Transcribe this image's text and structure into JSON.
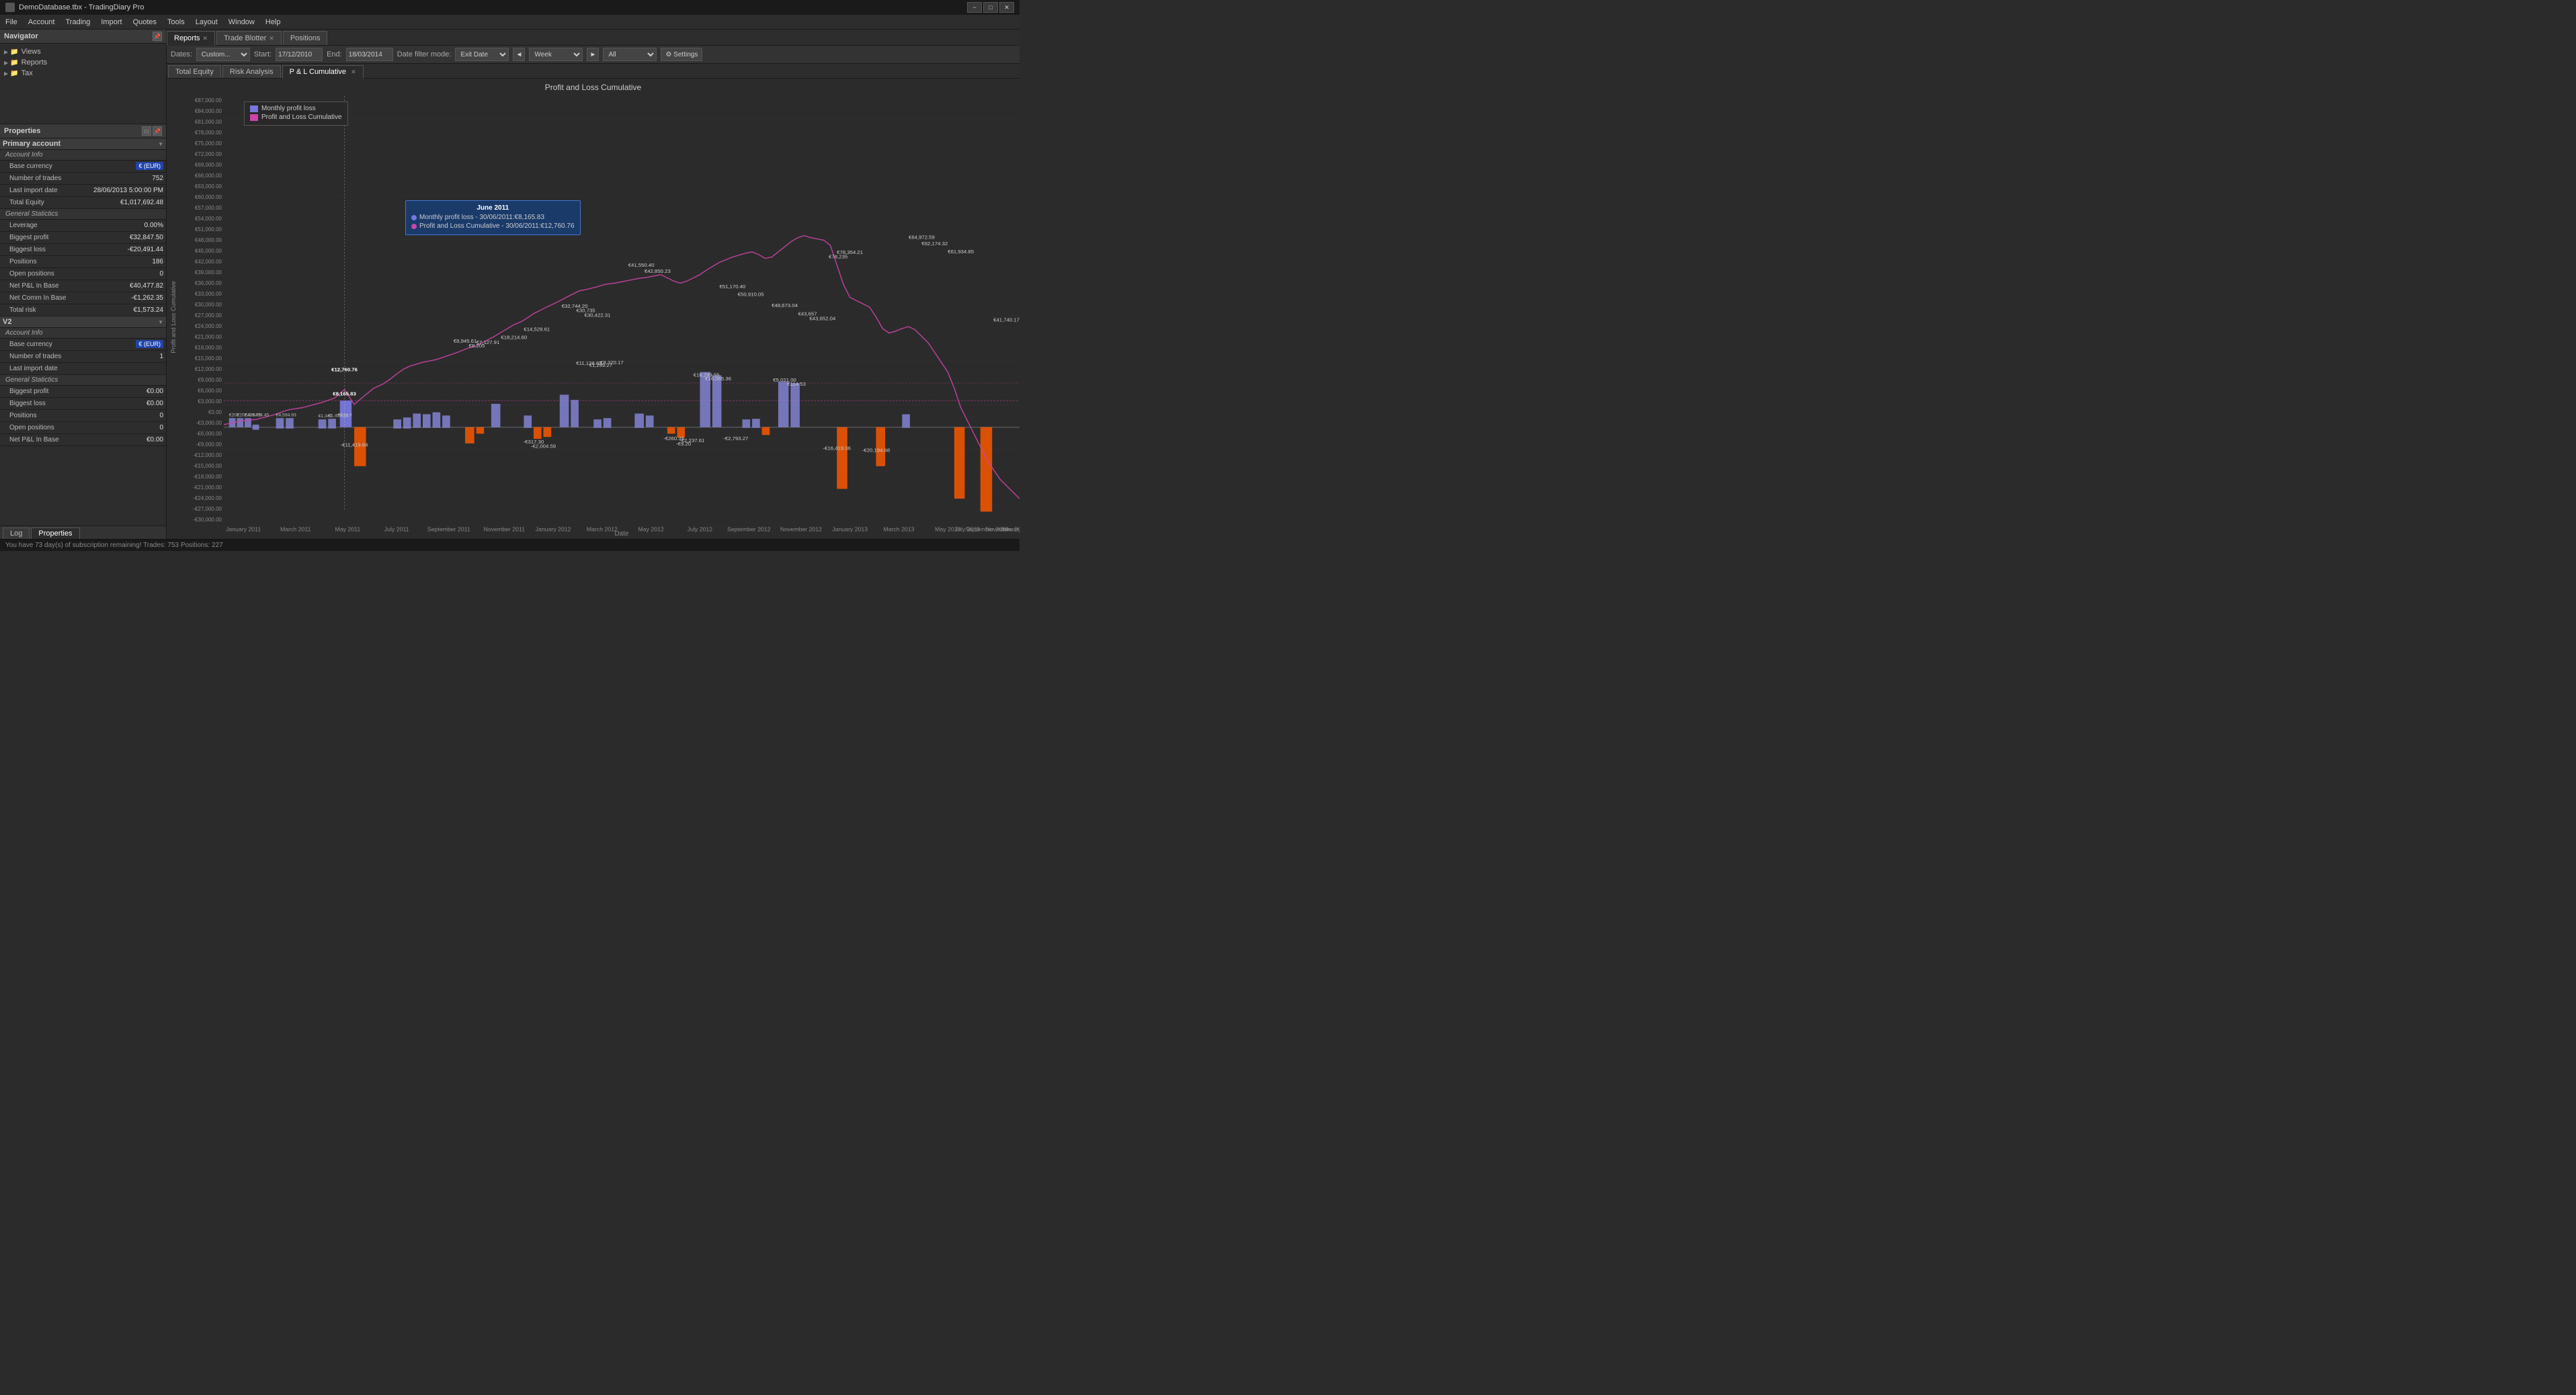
{
  "titlebar": {
    "title": "DemoDatabase.tbx - TradingDiary Pro",
    "icon": "app-icon",
    "min_btn": "−",
    "max_btn": "□",
    "close_btn": "✕"
  },
  "menubar": {
    "items": [
      "File",
      "Account",
      "Trading",
      "Import",
      "Quotes",
      "Tools",
      "Layout",
      "Window",
      "Help"
    ]
  },
  "tabs": [
    {
      "label": "Reports",
      "closeable": true,
      "active": true
    },
    {
      "label": "Trade Blotter",
      "closeable": true,
      "active": false
    },
    {
      "label": "Positions",
      "closeable": false,
      "active": false
    }
  ],
  "toolbar": {
    "dates_label": "Dates:",
    "dates_value": "Custom...",
    "start_label": "Start:",
    "start_value": "17/12/2010",
    "end_label": "End:",
    "end_value": "18/03/2014",
    "filter_label": "Date filter mode:",
    "filter_value": "Exit Date",
    "prev_btn": "◄",
    "period_value": "Week",
    "next_btn": "►",
    "all_value": "All",
    "settings_label": "⚙ Settings"
  },
  "sub_tabs": [
    {
      "label": "Total Equity",
      "closeable": false,
      "active": false
    },
    {
      "label": "Risk Analysis",
      "closeable": false,
      "active": false
    },
    {
      "label": "P & L Cumulative",
      "closeable": true,
      "active": true
    }
  ],
  "chart": {
    "title": "Profit and Loss Cumulative",
    "y_axis_label": "Profit and Loss Cumulative",
    "x_axis_label": "Date",
    "legend": [
      {
        "color": "#7777dd",
        "label": "Monthly profit loss"
      },
      {
        "color": "#cc44aa",
        "label": "Profit and Loss Cumulative"
      }
    ],
    "tooltip": {
      "title": "June 2011",
      "line1": "Monthly profit loss - 30/06/2011:€8,165.83",
      "line2": "Profit and Loss Cumulative - 30/06/2011:€12,760.76",
      "dot1_color": "#7777dd",
      "dot2_color": "#cc44aa"
    },
    "y_labels": [
      "€87,000.00",
      "€84,000.00",
      "€81,000.00",
      "€78,000.00",
      "€75,000.00",
      "€72,000.00",
      "€69,000.00",
      "€66,000.00",
      "€63,000.00",
      "€60,000.00",
      "€57,000.00",
      "€54,000.00",
      "€51,000.00",
      "€48,000.00",
      "€45,000.00",
      "€42,000.00",
      "€39,000.00",
      "€36,000.00",
      "€33,000.00",
      "€30,000.00",
      "€27,000.00",
      "€24,000.00",
      "€21,000.00",
      "€18,000.00",
      "€15,000.00",
      "€12,000.00",
      "€9,000.00",
      "€6,000.00",
      "€3,000.00",
      "€0.00",
      "€-3,000.00",
      "€-6,000.00",
      "€-9,000.00",
      "€-12,000.00",
      "€-15,000.00",
      "€-18,000.00",
      "€-21,000.00",
      "€-24,000.00",
      "€-27,000.00",
      "€-30,000.00"
    ],
    "x_labels": [
      "January 2011",
      "March 2011",
      "May 2011",
      "July 2011",
      "September 2011",
      "November 2011",
      "January 2012",
      "March 2012",
      "May 2012",
      "July 2012",
      "September 2012",
      "November 2012",
      "January 2013",
      "March 2013",
      "May 2013",
      "July 2013",
      "September 2013",
      "November 2013",
      "January 2014"
    ],
    "highlighted_values": {
      "v1": "€78,235",
      "v2": "€78,354.21",
      "v3": "€64,972.59",
      "v4": "€62,174.32",
      "v5": "€61,934.85",
      "v6": "€51,170.40",
      "v7": "€50,910.05",
      "v8": "€48,673.04",
      "v9": "€43,657",
      "v10": "€43,652.04",
      "v11": "€42,850.23",
      "v12": "€41,550.40",
      "v13": "€41,740.17",
      "v14": "€32,744.20",
      "v15": "€30,735",
      "v16": "€30,422.31",
      "v17": "€14,529.61",
      "v18": "€12,760.76",
      "v19": "€8,945.61",
      "v20": "€8,165.83",
      "v21": "€8,205",
      "v22": "€7,127.91",
      "v23": "€18,214.60",
      "v24": "€11,128.65",
      "v25": "€1,299.27",
      "v26": "€8,320.17",
      "v27": "€16,299.55",
      "v28": "€16,065.36",
      "v29": "€5,021.00",
      "v30": "€114.53",
      "cumulative_highlight": "€12,760.76",
      "bar_highlight": "€8,165.83"
    }
  },
  "navigator": {
    "title": "Navigator",
    "items": [
      {
        "label": "Views",
        "level": 0,
        "expanded": true
      },
      {
        "label": "Reports",
        "level": 0,
        "expanded": true
      },
      {
        "label": "Tax",
        "level": 0,
        "expanded": false
      }
    ]
  },
  "properties": {
    "title": "Properties",
    "sections": [
      {
        "name": "Primary account",
        "sub_sections": [
          {
            "name": "Account Info",
            "rows": [
              {
                "label": "Base currency",
                "value": "€ (EUR)",
                "value_type": "blue"
              },
              {
                "label": "Number of trades",
                "value": "752"
              },
              {
                "label": "Last import date",
                "value": "28/06/2013 5:00:00 PM"
              },
              {
                "label": "Total Equity",
                "value": "€1,017,692.48"
              }
            ]
          },
          {
            "name": "General Statictics",
            "rows": [
              {
                "label": "Leverage",
                "value": "0.00%"
              },
              {
                "label": "Biggest profit",
                "value": "€32,847.50"
              },
              {
                "label": "Biggest loss",
                "value": "-€20,491.44"
              },
              {
                "label": "Positions",
                "value": "186"
              },
              {
                "label": "Open positions",
                "value": "0"
              },
              {
                "label": "Net P&L In Base",
                "value": "€40,477.82"
              },
              {
                "label": "Net Comm In Base",
                "value": "-€1,262.35"
              },
              {
                "label": "Total risk",
                "value": "€1,573.24"
              }
            ]
          }
        ]
      },
      {
        "name": "V2",
        "sub_sections": [
          {
            "name": "Account Info",
            "rows": [
              {
                "label": "Base currency",
                "value": "€ (EUR)",
                "value_type": "blue"
              },
              {
                "label": "Number of trades",
                "value": "1"
              },
              {
                "label": "Last import date",
                "value": ""
              }
            ]
          },
          {
            "name": "General Statictics",
            "rows": [
              {
                "label": "Biggest profit",
                "value": "€0.00"
              },
              {
                "label": "Biggest loss",
                "value": "€0.00"
              },
              {
                "label": "Positions",
                "value": "0"
              },
              {
                "label": "Open positions",
                "value": "0"
              },
              {
                "label": "Net P&L In Base",
                "value": "€0.00"
              }
            ]
          }
        ]
      }
    ]
  },
  "bottom_tabs": [
    {
      "label": "Log",
      "active": false
    },
    {
      "label": "Properties",
      "active": true
    }
  ],
  "statusbar": {
    "text": "You have 73 day(s) of subscription remaining!  Trades: 753  Positions: 227"
  }
}
